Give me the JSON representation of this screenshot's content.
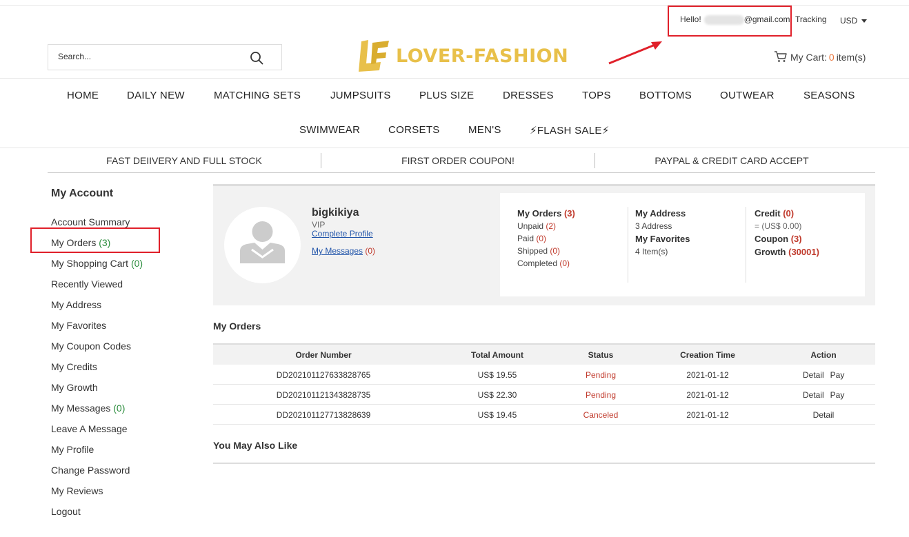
{
  "topbar": {
    "hello_prefix": "Hello!",
    "email_suffix": "@gmail.com",
    "tracking": "Tracking",
    "currency": "USD"
  },
  "header": {
    "search_placeholder": "Search...",
    "logo_text": "LOVER-FASHION",
    "cart_label": "My Cart:",
    "cart_count": "0",
    "cart_unit": "item(s)"
  },
  "nav": {
    "row1": [
      "HOME",
      "DAILY NEW",
      "MATCHING SETS",
      "JUMPSUITS",
      "PLUS SIZE",
      "DRESSES",
      "TOPS",
      "BOTTOMS",
      "OUTWEAR",
      "SEASONS"
    ],
    "row2": [
      "SWIMWEAR",
      "CORSETS",
      "MEN'S",
      "⚡FLASH SALE⚡"
    ]
  },
  "promo": [
    "FAST DEIIVERY AND FULL STOCK",
    "FIRST ORDER COUPON!",
    "PAYPAL & CREDIT CARD ACCEPT"
  ],
  "sidebar": {
    "title": "My Account",
    "items": [
      {
        "label": "Account Summary",
        "count": ""
      },
      {
        "label": "My Orders",
        "count": "(3)"
      },
      {
        "label": "My Shopping Cart",
        "count": "(0)"
      },
      {
        "label": "Recently Viewed",
        "count": ""
      },
      {
        "label": "My Address",
        "count": ""
      },
      {
        "label": "My Favorites",
        "count": ""
      },
      {
        "label": "My Coupon Codes",
        "count": ""
      },
      {
        "label": "My Credits",
        "count": ""
      },
      {
        "label": "My Growth",
        "count": ""
      },
      {
        "label": "My Messages",
        "count": "(0)"
      },
      {
        "label": "Leave A Message",
        "count": ""
      },
      {
        "label": "My Profile",
        "count": ""
      },
      {
        "label": "Change Password",
        "count": ""
      },
      {
        "label": "My Reviews",
        "count": ""
      },
      {
        "label": "Logout",
        "count": ""
      }
    ]
  },
  "profile": {
    "username": "bigkikiya",
    "level": "VIP",
    "complete_profile": "Complete Profile",
    "messages_label": "My Messages",
    "messages_count": "(0)"
  },
  "stats": {
    "orders": {
      "label": "My Orders",
      "count": "(3)"
    },
    "unpaid": {
      "label": "Unpaid",
      "count": "(2)"
    },
    "paid": {
      "label": "Paid",
      "count": "(0)"
    },
    "shipped": {
      "label": "Shipped",
      "count": "(0)"
    },
    "completed": {
      "label": "Completed",
      "count": "(0)"
    },
    "address": {
      "label": "My Address",
      "value": "3 Address"
    },
    "favorites": {
      "label": "My Favorites",
      "value": "4 Item(s)"
    },
    "credit": {
      "label": "Credit",
      "count": "(0)",
      "value": "= (US$ 0.00)"
    },
    "coupon": {
      "label": "Coupon",
      "count": "(3)"
    },
    "growth": {
      "label": "Growth",
      "count": "(30001)"
    }
  },
  "orders": {
    "title": "My Orders",
    "columns": [
      "Order Number",
      "Total Amount",
      "Status",
      "Creation Time",
      "Action"
    ],
    "rows": [
      {
        "number": "DD202101127633828765",
        "amount": "US$ 19.55",
        "status": "Pending",
        "time": "2021-01-12",
        "detail": "Detail",
        "pay": "Pay"
      },
      {
        "number": "DD202101121343828735",
        "amount": "US$ 22.30",
        "status": "Pending",
        "time": "2021-01-12",
        "detail": "Detail",
        "pay": "Pay"
      },
      {
        "number": "DD202101127713828639",
        "amount": "US$ 19.45",
        "status": "Canceled",
        "time": "2021-01-12",
        "detail": "Detail",
        "pay": ""
      }
    ]
  },
  "also_like": "You May Also Like",
  "colors": {
    "accent_red": "#c0392b",
    "logo_gold": "#e8c04a",
    "annotation_red": "#e0202a"
  }
}
